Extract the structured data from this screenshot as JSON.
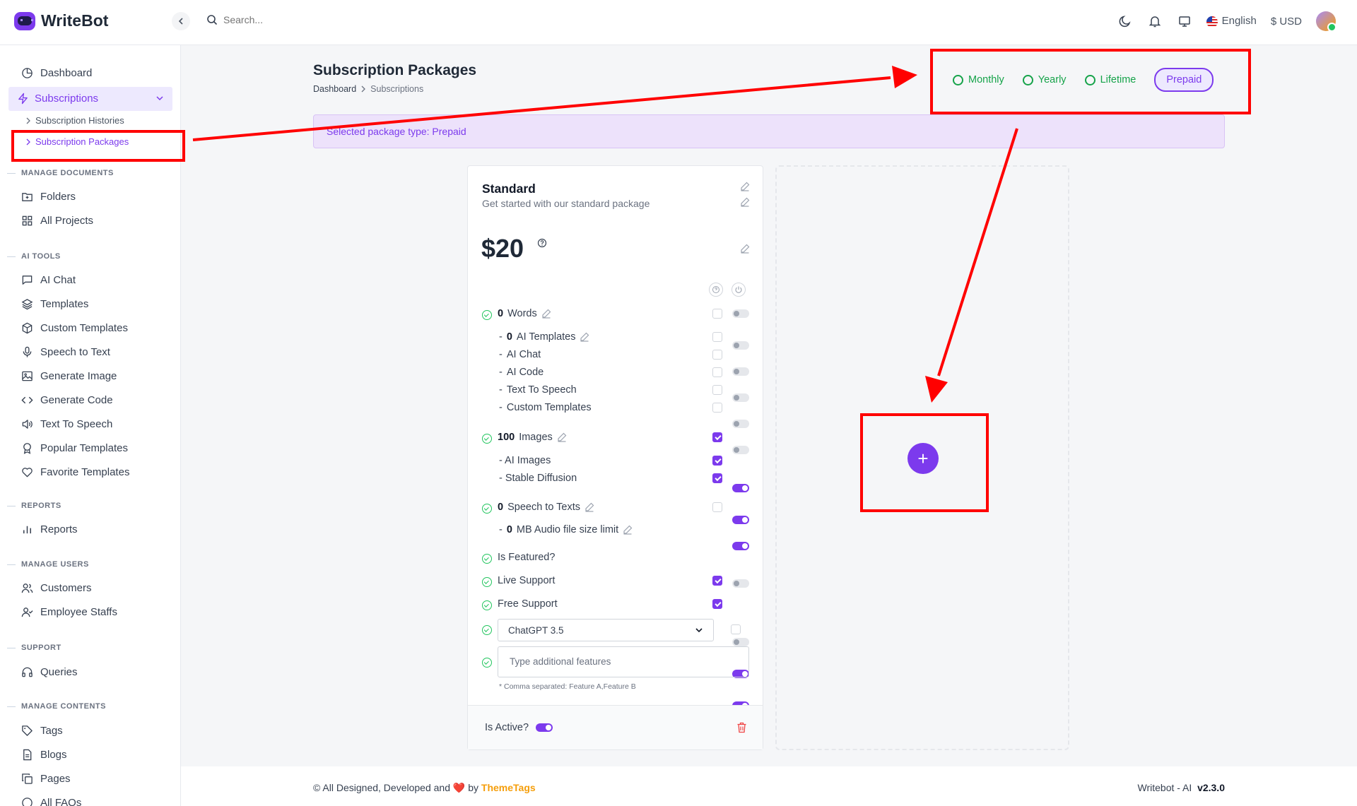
{
  "app": {
    "name": "WriteBot"
  },
  "topbar": {
    "search_placeholder": "Search...",
    "language": "English",
    "currency": "$ USD"
  },
  "sidebar": {
    "dashboard": "Dashboard",
    "subscriptions": "Subscriptions",
    "subscription_histories": "Subscription Histories",
    "subscription_packages": "Subscription Packages",
    "sections": {
      "manage_documents": "MANAGE DOCUMENTS",
      "ai_tools": "AI TOOLS",
      "reports": "REPORTS",
      "manage_users": "MANAGE USERS",
      "support": "SUPPORT",
      "manage_contents": "MANAGE CONTENTS"
    },
    "folders": "Folders",
    "all_projects": "All Projects",
    "ai_chat": "AI Chat",
    "templates": "Templates",
    "custom_templates": "Custom Templates",
    "speech_to_text": "Speech to Text",
    "generate_image": "Generate Image",
    "generate_code": "Generate Code",
    "text_to_speech": "Text To Speech",
    "popular_templates": "Popular Templates",
    "favorite_templates": "Favorite Templates",
    "reports": "Reports",
    "customers": "Customers",
    "employee_staffs": "Employee Staffs",
    "queries": "Queries",
    "tags": "Tags",
    "blogs": "Blogs",
    "pages": "Pages",
    "all_faqs": "All FAQs"
  },
  "page": {
    "title": "Subscription Packages",
    "breadcrumb": [
      "Dashboard",
      "Subscriptions"
    ],
    "package_types": [
      "Monthly",
      "Yearly",
      "Lifetime",
      "Prepaid"
    ],
    "selected_type": "Prepaid",
    "alert": "Selected package type: Prepaid"
  },
  "package": {
    "name": "Standard",
    "description": "Get started with our standard package",
    "price": "$20",
    "words": {
      "count": "0",
      "label": "Words"
    },
    "words_sub": [
      {
        "prefix": "- ",
        "count": "0",
        "label": "AI Templates",
        "checked": false,
        "enabled": false
      },
      {
        "prefix": "- ",
        "label": "AI Chat",
        "checked": false,
        "enabled": false
      },
      {
        "prefix": "- ",
        "label": "AI Code",
        "checked": false,
        "enabled": false
      },
      {
        "prefix": "- ",
        "label": "Text To Speech",
        "checked": false,
        "enabled": false
      },
      {
        "prefix": "- ",
        "label": "Custom Templates",
        "checked": false,
        "enabled": false
      }
    ],
    "images": {
      "count": "100",
      "label": "Images"
    },
    "images_sub": [
      {
        "label": "- AI Images",
        "checked": true,
        "enabled": true
      },
      {
        "label": "- Stable Diffusion",
        "checked": true,
        "enabled": true
      }
    ],
    "speech": {
      "count": "0",
      "label": "Speech to Texts"
    },
    "audio": {
      "count": "0",
      "label": "MB Audio file size limit"
    },
    "is_featured": "Is Featured?",
    "live_support": "Live Support",
    "free_support": "Free Support",
    "model": "ChatGPT 3.5",
    "additional_placeholder": "Type additional features",
    "additional_hint": "* Comma separated: Feature A,Feature B",
    "is_active": "Is Active?"
  },
  "add_button": "+",
  "footer": {
    "left_prefix": "© All Designed, Developed and",
    "heart": "❤️",
    "by": "by",
    "brand": "ThemeTags",
    "right_label": "Writebot - AI",
    "version": "v2.3.0"
  },
  "colors": {
    "accent": "#7c3aed",
    "success": "#16a34a",
    "annotation": "#ff0000",
    "brand_footer": "#f59e0b"
  }
}
